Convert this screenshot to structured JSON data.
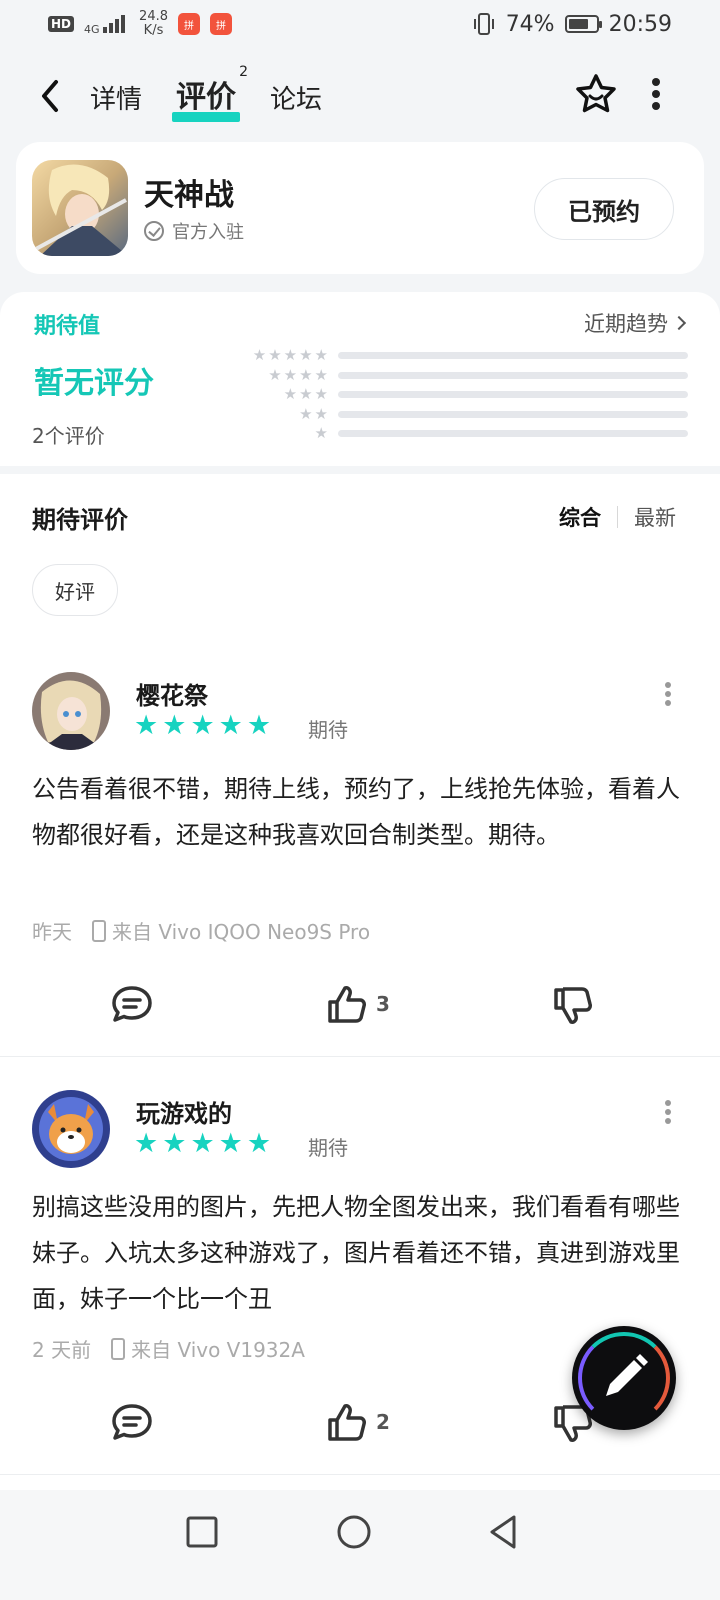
{
  "status_bar": {
    "hd": "HD",
    "network": "4G",
    "speed_value": "24.8",
    "speed_unit": "K/s",
    "battery_percent": "74%",
    "battery_level": 0.74,
    "time": "20:59"
  },
  "nav": {
    "tabs": [
      {
        "label": "详情"
      },
      {
        "label": "评价",
        "badge": "2"
      },
      {
        "label": "论坛"
      }
    ]
  },
  "game": {
    "name": "天神战",
    "badge": "官方入驻",
    "reserve_label": "已预约"
  },
  "rating": {
    "label": "期待值",
    "trend_label": "近期趋势",
    "score_text": "暂无评分",
    "count_text": "2个评价",
    "distribution": [
      {
        "stars": 5,
        "fraction": 0
      },
      {
        "stars": 4,
        "fraction": 0
      },
      {
        "stars": 3,
        "fraction": 0
      },
      {
        "stars": 2,
        "fraction": 0
      },
      {
        "stars": 1,
        "fraction": 0
      }
    ]
  },
  "reviews_section": {
    "title": "期待评价",
    "sort_options": [
      "综合",
      "最新"
    ],
    "filter_chip": "好评"
  },
  "reviews": [
    {
      "user": "樱花祭",
      "stars": 5,
      "tag": "期待",
      "text": "公告看着很不错，期待上线，预约了，上线抢先体验，看着人物都很好看，还是这种我喜欢回合制类型。期待。",
      "time": "昨天",
      "device": "来自 Vivo IQOO Neo9S Pro",
      "likes": "3"
    },
    {
      "user": "玩游戏的",
      "stars": 5,
      "tag": "期待",
      "text": "别搞这些没用的图片，先把人物全图发出来，我们看看有哪些妹子。入坑太多这种游戏了，图片看着还不错，真进到游戏里面，妹子一个比一个丑",
      "time": "2 天前",
      "device": "来自 Vivo V1932A",
      "likes": "2"
    }
  ],
  "colors": {
    "accent": "#17d3c0",
    "accent_text": "#15c7b6"
  }
}
